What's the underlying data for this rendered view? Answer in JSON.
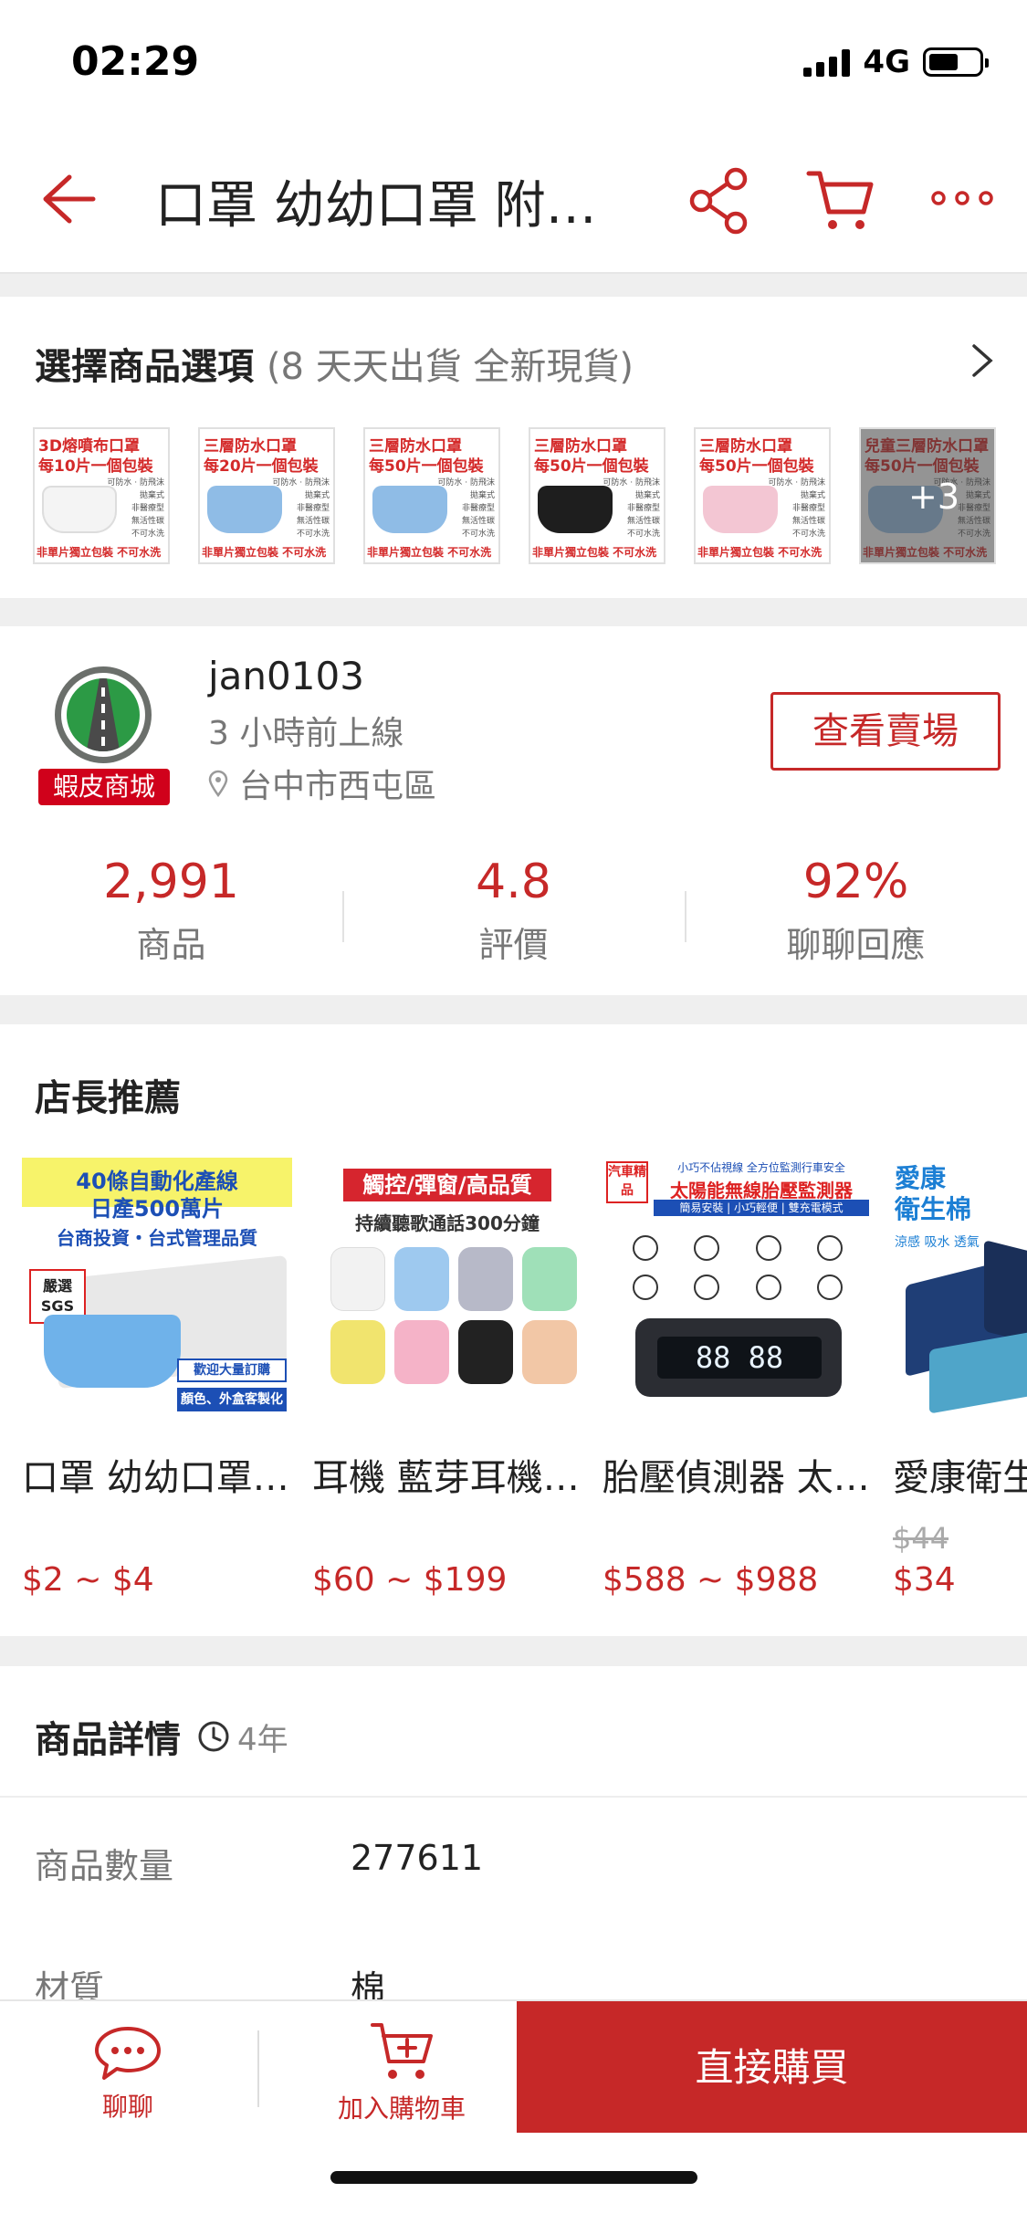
{
  "status": {
    "time": "02:29",
    "network": "4G"
  },
  "nav": {
    "title": "口罩 幼幼口罩 附…"
  },
  "options": {
    "title": "選擇商品選項",
    "subtitle": "(8 天天出貨 全新現貨)",
    "thumbs": [
      {
        "line1": "3D熔噴布口罩",
        "line2": "每10片一個包裝",
        "footer": "非單片獨立包裝 不可水洗",
        "mask_color": "#f4f4f4"
      },
      {
        "line1": "三層防水口罩",
        "line2": "每20片一個包裝",
        "footer": "非單片獨立包裝 不可水洗",
        "mask_color": "#8fbce6"
      },
      {
        "line1": "三層防水口罩",
        "line2": "每50片一個包裝",
        "footer": "非單片獨立包裝 不可水洗",
        "mask_color": "#8fbce6"
      },
      {
        "line1": "三層防水口罩",
        "line2": "每50片一個包裝",
        "footer": "非單片獨立包裝 不可水洗",
        "mask_color": "#1e1e1e"
      },
      {
        "line1": "三層防水口罩",
        "line2": "每50片一個包裝",
        "footer": "非單片獨立包裝 不可水洗",
        "mask_color": "#f3c6d3"
      },
      {
        "line1": "兒童三層防水口罩",
        "line2": "每50片一個包裝",
        "footer": "非單片獨立包裝 不可水洗",
        "mask_color": "#9cc4e8",
        "more": "+3"
      }
    ],
    "features": "可防水 · 防飛沫\n拋棄式\n非醫療型\n無活性碳\n不可水洗"
  },
  "shop": {
    "badge": "蝦皮商城",
    "name": "jan0103",
    "online": "3 小時前上線",
    "location": "台中市西屯區",
    "view_button": "查看賣場",
    "stats": [
      {
        "value": "2,991",
        "label": "商品"
      },
      {
        "value": "4.8",
        "label": "評價"
      },
      {
        "value": "92%",
        "label": "聊聊回應"
      }
    ]
  },
  "recs": {
    "title": "店長推薦",
    "items": [
      {
        "name": "口罩 幼幼口罩 附…",
        "old_price": "",
        "price": "$2 ~ $4",
        "img": {
          "l1": "40條自動化產線",
          "l2": "日產500萬片",
          "l3": "台商投資・台式管理品質",
          "badge": "嚴選 SGS",
          "tag1": "歡迎大量訂購",
          "tag2": "顏色、外盒客製化"
        }
      },
      {
        "name": "耳機 藍芽耳機 無線…",
        "old_price": "",
        "price": "$60 ~ $199",
        "img": {
          "l1": "觸控/彈窗/高品質",
          "l2": "持續聽歌通話300分鐘"
        }
      },
      {
        "name": "胎壓偵測器 太陽能…",
        "old_price": "",
        "price": "$588 ~ $988",
        "img": {
          "l1": "小巧不佔視線 全方位監測行車安全",
          "l2": "太陽能無線胎壓監測器",
          "l3": "簡易安裝 | 小巧輕便 | 雙充電模式",
          "tag": "汽車精品",
          "readout": "88 88"
        }
      },
      {
        "name": "愛康衛生棉 涼感…",
        "old_price": "$44",
        "price": "$34",
        "img": {
          "l1": "愛康",
          "l2": "衛生棉",
          "l3": "涼感 吸水 透氣"
        }
      }
    ]
  },
  "details": {
    "title": "商品詳情",
    "age": "4年",
    "rows": [
      {
        "label": "商品數量",
        "value": "277611"
      },
      {
        "label": "材質",
        "value": "棉"
      }
    ]
  },
  "bottom": {
    "chat": "聊聊",
    "add_cart": "加入購物車",
    "buy": "直接購買"
  },
  "colors": {
    "accent": "#c62828",
    "mall_badge": "#d0011b"
  }
}
